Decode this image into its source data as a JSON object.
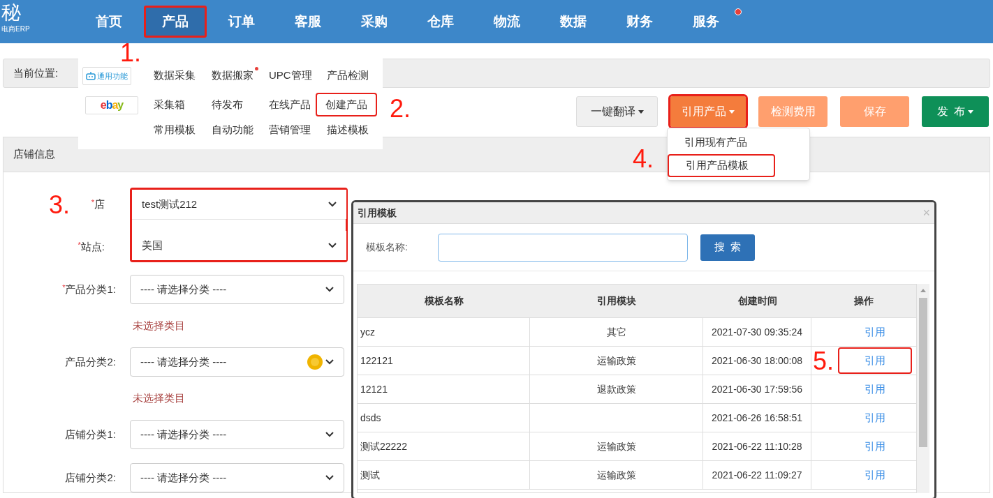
{
  "logo": {
    "mark": "秘",
    "subtitle": "电商ERP"
  },
  "nav": [
    {
      "label": "首页",
      "selected": false,
      "highlighted": false,
      "badge": false
    },
    {
      "label": "产品",
      "selected": true,
      "highlighted": true,
      "badge": false
    },
    {
      "label": "订单",
      "selected": false,
      "highlighted": false,
      "badge": false
    },
    {
      "label": "客服",
      "selected": false,
      "highlighted": false,
      "badge": false
    },
    {
      "label": "采购",
      "selected": false,
      "highlighted": false,
      "badge": false
    },
    {
      "label": "仓库",
      "selected": false,
      "highlighted": false,
      "badge": false
    },
    {
      "label": "物流",
      "selected": false,
      "highlighted": false,
      "badge": false
    },
    {
      "label": "数据",
      "selected": false,
      "highlighted": false,
      "badge": false
    },
    {
      "label": "财务",
      "selected": false,
      "highlighted": false,
      "badge": false
    },
    {
      "label": "服务",
      "selected": false,
      "highlighted": false,
      "badge": true
    }
  ],
  "breadcrumb": {
    "label": "当前位置:"
  },
  "menu": {
    "sections": [
      {
        "kind": "general",
        "tag": "通用功能",
        "items": [
          {
            "label": "数据采集",
            "badge": false,
            "highlighted": false
          },
          {
            "label": "数据搬家",
            "badge": true,
            "highlighted": false
          },
          {
            "label": "UPC管理",
            "badge": false,
            "highlighted": false
          },
          {
            "label": "产品检测",
            "badge": false,
            "highlighted": false
          }
        ]
      },
      {
        "kind": "ebay",
        "tag": "ebay",
        "items": [
          {
            "label": "采集箱",
            "badge": false,
            "highlighted": false
          },
          {
            "label": "待发布",
            "badge": false,
            "highlighted": false
          },
          {
            "label": "在线产品",
            "badge": false,
            "highlighted": false
          },
          {
            "label": "创建产品",
            "badge": false,
            "highlighted": true
          },
          {
            "label": "常用模板",
            "badge": false,
            "highlighted": false
          },
          {
            "label": "自动功能",
            "badge": false,
            "highlighted": false
          },
          {
            "label": "营销管理",
            "badge": false,
            "highlighted": false
          },
          {
            "label": "描述模板",
            "badge": false,
            "highlighted": false
          }
        ]
      }
    ]
  },
  "toolbar": [
    {
      "label": "一键翻译",
      "kind": "default",
      "caret": true,
      "highlighted": false
    },
    {
      "label": "引用产品",
      "kind": "primary",
      "caret": true,
      "highlighted": true
    },
    {
      "label": "检测费用",
      "kind": "light",
      "caret": false,
      "highlighted": false
    },
    {
      "label": "保存",
      "kind": "light",
      "caret": false,
      "highlighted": false
    },
    {
      "label": "发  布",
      "kind": "success",
      "caret": true,
      "highlighted": false
    }
  ],
  "reference_menu": [
    {
      "label": "引用现有产品",
      "highlighted": false
    },
    {
      "label": "引用产品模板",
      "highlighted": true
    }
  ],
  "panel": {
    "title": "店铺信息"
  },
  "form_groups": [
    {
      "highlighted": true,
      "fields": [
        {
          "marker": "*",
          "label": "店",
          "value": "test测试212",
          "coin": false
        },
        {
          "marker": "*",
          "label": "站点:",
          "value": "美国",
          "coin": false
        }
      ]
    },
    {
      "highlighted": false,
      "fields": [
        {
          "marker": "*",
          "label": "产品分类1:",
          "value": "---- 请选择分类 ----",
          "coin": false,
          "note": "未选择类目"
        },
        {
          "label": "产品分类2:",
          "value": "---- 请选择分类 ----",
          "coin": true,
          "note": "未选择类目"
        },
        {
          "label": "店铺分类1:",
          "value": "---- 请选择分类 ----",
          "coin": false
        },
        {
          "label": "店铺分类2:",
          "value": "---- 请选择分类 ----",
          "coin": false
        }
      ]
    }
  ],
  "modal": {
    "title": "引用模板",
    "close": "×",
    "search_label": "模板名称:",
    "search_button": "搜  索",
    "columns": [
      "模板名称",
      "引用模块",
      "创建时间",
      "操作"
    ],
    "rows": [
      {
        "name": "ycz",
        "module": "其它",
        "time": "2021-07-30 09:35:24",
        "action": "引用",
        "highlighted": false
      },
      {
        "name": "122121",
        "module": "运输政策",
        "time": "2021-06-30 18:00:08",
        "action": "引用",
        "highlighted": true
      },
      {
        "name": "12121",
        "module": "退款政策",
        "time": "2021-06-30 17:59:56",
        "action": "引用",
        "highlighted": false
      },
      {
        "name": "dsds",
        "time": "2021-06-26 16:58:51",
        "action": "引用",
        "highlighted": false
      },
      {
        "name": "测试22222",
        "module": "运输政策",
        "time": "2021-06-22 11:10:28",
        "action": "引用",
        "highlighted": false
      },
      {
        "name": "测试",
        "module": "运输政策",
        "time": "2021-06-22 11:09:27",
        "action": "引用",
        "highlighted": false
      }
    ]
  },
  "annotations": [
    "1.",
    "2.",
    "3.",
    "4.",
    "5."
  ]
}
